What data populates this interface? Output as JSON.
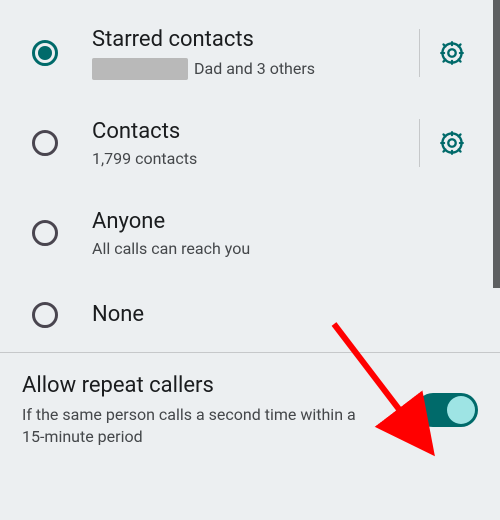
{
  "options": {
    "starred": {
      "label": "Starred contacts",
      "subtitle_suffix": "Dad and 3 others",
      "selected": true,
      "has_settings": true
    },
    "contacts": {
      "label": "Contacts",
      "subtitle": "1,799 contacts",
      "selected": false,
      "has_settings": true
    },
    "anyone": {
      "label": "Anyone",
      "subtitle": "All calls can reach you",
      "selected": false,
      "has_settings": false
    },
    "none": {
      "label": "None",
      "subtitle": "",
      "selected": false,
      "has_settings": false
    }
  },
  "repeat_callers": {
    "title": "Allow repeat callers",
    "subtitle": "If the same person calls a second time within a 15-minute period",
    "enabled": true
  },
  "colors": {
    "accent": "#006a6a",
    "arrow": "#ff0000"
  }
}
